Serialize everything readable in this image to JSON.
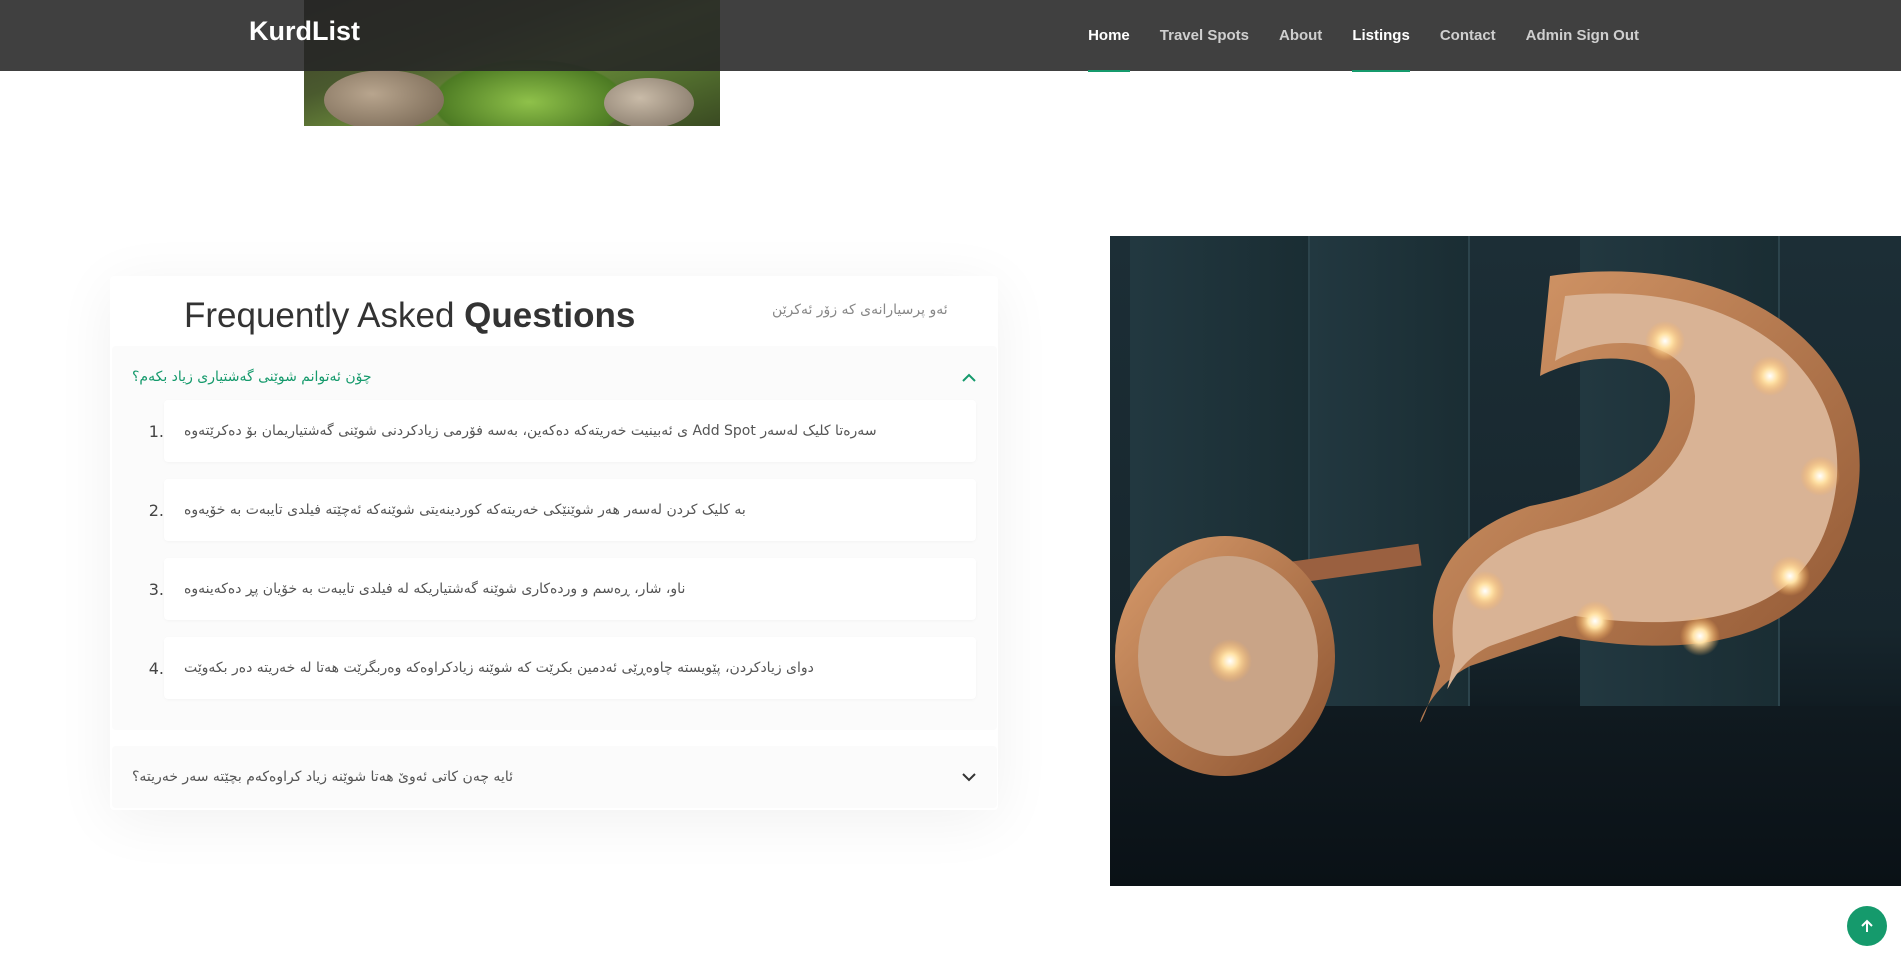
{
  "navbar": {
    "brand": "KurdList",
    "links": [
      {
        "label": "Home",
        "active": true
      },
      {
        "label": "Travel Spots",
        "active": false
      },
      {
        "label": "About",
        "active": false
      },
      {
        "label": "Listings",
        "active": true
      },
      {
        "label": "Contact",
        "active": false
      },
      {
        "label": "Admin Sign Out",
        "active": false
      }
    ]
  },
  "faq": {
    "title_light": "Frequently Asked",
    "title_bold": "Questions",
    "subtitle": "ئەو پرسیارانەی کە زۆر ئەکرێن",
    "items": [
      {
        "question": "چۆن ئەتوانم شوێنی گەشتیاری زیاد بکەم؟",
        "expanded": true,
        "steps": [
          {
            "num": "1.",
            "text": "ی ئەبینیت خەریتەکە دەکەین، بەسە فۆرمی زیادکردنی شوێنی گەشتیاریمان بۆ دەکرێتەوە Add Spot سەرەتا کلیک لەسەر"
          },
          {
            "num": "2.",
            "text": "بە کلیک کردن لەسەر هەر شوێنێکی خەریتەکە کوردینەیتی شوێنەکە ئەچێتە فیلدی تایبەت بە خۆیەوە"
          },
          {
            "num": "3.",
            "text": "ناو، شار، ڕەسم و وردەکاری شوێنە گەشتیاریکە لە فیلدی تایبەت بە خۆیان پڕ دەکەینەوە"
          },
          {
            "num": "4.",
            "text": "دوای زیادکردن، پێویستە چاوەڕێی ئەدمین بکرێت کە شوێنە زیادکراوەکە وەربگرێت هەتا لە خەریتە دەر بکەوێت"
          }
        ]
      },
      {
        "question": "ئایە چەن کاتی ئەوێ هەتا شوێنە زیاد کراوەکەم بچێتە سەر خەریتە؟",
        "expanded": false
      }
    ]
  },
  "colors": {
    "accent": "#159a6c",
    "navbar": "#262626"
  },
  "icons": [
    "chevron-up-icon",
    "chevron-down-icon",
    "arrow-up-icon"
  ]
}
